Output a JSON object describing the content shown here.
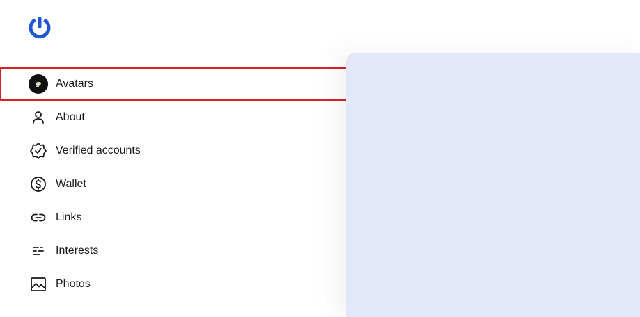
{
  "app": {
    "logo_icon": "power-ring-logo",
    "brand_color": "#1f57d6"
  },
  "nav": {
    "items": [
      {
        "label": "Avatars",
        "icon": "avatar-image-icon",
        "selected": true
      },
      {
        "label": "About",
        "icon": "person-icon"
      },
      {
        "label": "Verified accounts",
        "icon": "verified-badge-icon"
      },
      {
        "label": "Wallet",
        "icon": "dollar-circle-icon"
      },
      {
        "label": "Links",
        "icon": "link-icon"
      },
      {
        "label": "Interests",
        "icon": "interests-lines-icon"
      },
      {
        "label": "Photos",
        "icon": "photo-icon"
      }
    ]
  },
  "colors": {
    "selection_outline": "#d4202a",
    "preview_panel": "#e3e8f8"
  }
}
